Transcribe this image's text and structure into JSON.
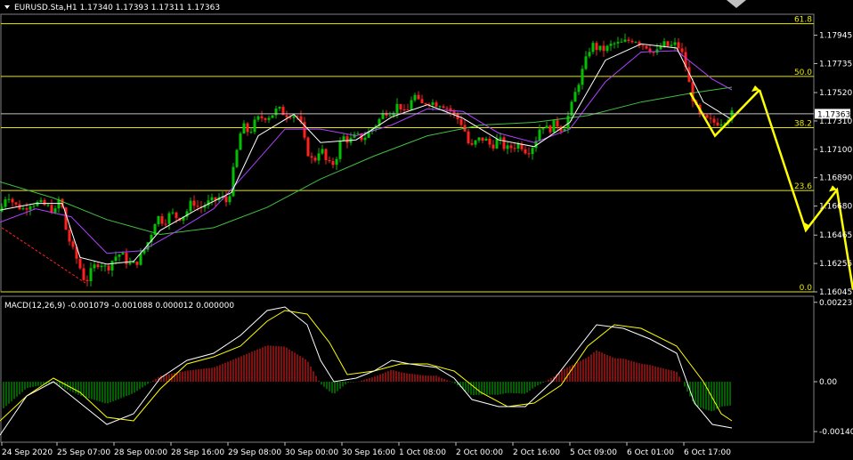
{
  "header": {
    "symbol_line": "EURUSD.Sta,H1  1.17340 1.17393 1.17311 1.17363",
    "macd_line": "MACD(12,26,9) -0.001079 -0.001088 0.000012 0.000000"
  },
  "chart_data": {
    "type": "candlestick",
    "price_axis": {
      "ticks": [
        "1.17945",
        "1.17735",
        "1.17520",
        "1.17310",
        "1.17100",
        "1.16890",
        "1.16680",
        "1.16465",
        "1.16255",
        "1.16045"
      ],
      "current_price": "1.17363",
      "range": [
        1.16045,
        1.181
      ]
    },
    "macd_axis": {
      "ticks": [
        "0.002231",
        "0.00",
        "-0.001401"
      ],
      "range": [
        -0.0017,
        0.0024
      ]
    },
    "time_axis": {
      "labels": [
        "24 Sep 2020",
        "25 Sep 07:00",
        "28 Sep 00:00",
        "28 Sep 16:00",
        "29 Sep 08:00",
        "30 Sep 00:00",
        "30 Sep 16:00",
        "1 Oct 08:00",
        "2 Oct 00:00",
        "2 Oct 16:00",
        "5 Oct 09:00",
        "6 Oct 01:00",
        "6 Oct 17:00"
      ]
    },
    "fibonacci": [
      {
        "label": "61.8",
        "price": 1.1803
      },
      {
        "label": "50.0",
        "price": 1.1764
      },
      {
        "label": "38.2",
        "price": 1.1726
      },
      {
        "label": "23.6",
        "price": 1.16795
      },
      {
        "label": "0.0",
        "price": 1.16045
      }
    ],
    "price_path": [
      [
        0,
        1.1664
      ],
      [
        8,
        1.1678
      ],
      [
        16,
        1.1669
      ],
      [
        26,
        1.1666
      ],
      [
        34,
        1.167
      ],
      [
        44,
        1.167
      ],
      [
        52,
        1.1668
      ],
      [
        62,
        1.1664
      ],
      [
        68,
        1.1677
      ],
      [
        72,
        1.1655
      ],
      [
        80,
        1.1638
      ],
      [
        88,
        1.1626
      ],
      [
        96,
        1.1611
      ],
      [
        104,
        1.1622
      ],
      [
        112,
        1.1627
      ],
      [
        120,
        1.1621
      ],
      [
        128,
        1.163
      ],
      [
        136,
        1.1633
      ],
      [
        144,
        1.1625
      ],
      [
        152,
        1.1625
      ],
      [
        160,
        1.1633
      ],
      [
        168,
        1.1644
      ],
      [
        176,
        1.1661
      ],
      [
        184,
        1.1656
      ],
      [
        192,
        1.1663
      ],
      [
        200,
        1.1659
      ],
      [
        208,
        1.1662
      ],
      [
        216,
        1.1672
      ],
      [
        224,
        1.1666
      ],
      [
        232,
        1.167
      ],
      [
        240,
        1.1672
      ],
      [
        248,
        1.1675
      ],
      [
        256,
        1.167
      ],
      [
        264,
        1.1702
      ],
      [
        272,
        1.1728
      ],
      [
        280,
        1.1722
      ],
      [
        288,
        1.1732
      ],
      [
        296,
        1.1734
      ],
      [
        304,
        1.1735
      ],
      [
        312,
        1.174
      ],
      [
        320,
        1.1736
      ],
      [
        328,
        1.1736
      ],
      [
        336,
        1.1734
      ],
      [
        344,
        1.171
      ],
      [
        352,
        1.17
      ],
      [
        360,
        1.1712
      ],
      [
        368,
        1.1698
      ],
      [
        376,
        1.17
      ],
      [
        384,
        1.172
      ],
      [
        392,
        1.1716
      ],
      [
        400,
        1.172
      ],
      [
        408,
        1.1718
      ],
      [
        416,
        1.1724
      ],
      [
        424,
        1.173
      ],
      [
        432,
        1.1738
      ],
      [
        440,
        1.1738
      ],
      [
        448,
        1.1744
      ],
      [
        456,
        1.1734
      ],
      [
        464,
        1.1752
      ],
      [
        472,
        1.1742
      ],
      [
        480,
        1.1746
      ],
      [
        488,
        1.1744
      ],
      [
        496,
        1.1744
      ],
      [
        504,
        1.174
      ],
      [
        512,
        1.1734
      ],
      [
        520,
        1.1728
      ],
      [
        528,
        1.171
      ],
      [
        536,
        1.1717
      ],
      [
        544,
        1.1718
      ],
      [
        552,
        1.1712
      ],
      [
        560,
        1.1718
      ],
      [
        568,
        1.171
      ],
      [
        576,
        1.1712
      ],
      [
        584,
        1.1714
      ],
      [
        592,
        1.1708
      ],
      [
        600,
        1.1714
      ],
      [
        608,
        1.1729
      ],
      [
        616,
        1.1724
      ],
      [
        624,
        1.173
      ],
      [
        632,
        1.1724
      ],
      [
        640,
        1.1738
      ],
      [
        648,
        1.1756
      ],
      [
        656,
        1.1772
      ],
      [
        664,
        1.1788
      ],
      [
        672,
        1.1784
      ],
      [
        680,
        1.1784
      ],
      [
        688,
        1.1788
      ],
      [
        696,
        1.1788
      ],
      [
        704,
        1.179
      ],
      [
        712,
        1.1792
      ],
      [
        720,
        1.1788
      ],
      [
        728,
        1.1786
      ],
      [
        736,
        1.178
      ],
      [
        744,
        1.1788
      ],
      [
        752,
        1.1786
      ],
      [
        760,
        1.1788
      ],
      [
        768,
        1.1778
      ],
      [
        776,
        1.1752
      ],
      [
        784,
        1.1736
      ],
      [
        792,
        1.1732
      ],
      [
        800,
        1.173
      ],
      [
        808,
        1.173
      ],
      [
        816,
        1.1733
      ],
      [
        822,
        1.17363
      ]
    ],
    "ma_fast": [
      [
        0,
        1.1665
      ],
      [
        40,
        1.167
      ],
      [
        70,
        1.167
      ],
      [
        90,
        1.163
      ],
      [
        120,
        1.1625
      ],
      [
        150,
        1.1627
      ],
      [
        180,
        1.165
      ],
      [
        220,
        1.1665
      ],
      [
        260,
        1.1678
      ],
      [
        290,
        1.172
      ],
      [
        330,
        1.1736
      ],
      [
        360,
        1.1715
      ],
      [
        400,
        1.1717
      ],
      [
        440,
        1.1734
      ],
      [
        480,
        1.1743
      ],
      [
        520,
        1.1733
      ],
      [
        560,
        1.1717
      ],
      [
        600,
        1.1712
      ],
      [
        640,
        1.173
      ],
      [
        680,
        1.1776
      ],
      [
        720,
        1.1788
      ],
      [
        760,
        1.1785
      ],
      [
        790,
        1.1745
      ],
      [
        822,
        1.1732
      ]
    ],
    "ma_mid": [
      [
        0,
        1.1656
      ],
      [
        40,
        1.1666
      ],
      [
        80,
        1.166
      ],
      [
        120,
        1.1633
      ],
      [
        160,
        1.1635
      ],
      [
        200,
        1.165
      ],
      [
        240,
        1.1666
      ],
      [
        280,
        1.1695
      ],
      [
        320,
        1.1725
      ],
      [
        360,
        1.1725
      ],
      [
        400,
        1.172
      ],
      [
        440,
        1.1728
      ],
      [
        480,
        1.174
      ],
      [
        520,
        1.1738
      ],
      [
        560,
        1.1722
      ],
      [
        600,
        1.1715
      ],
      [
        640,
        1.1725
      ],
      [
        680,
        1.176
      ],
      [
        720,
        1.1782
      ],
      [
        760,
        1.1783
      ],
      [
        800,
        1.1762
      ],
      [
        822,
        1.1754
      ]
    ],
    "ma_slow": [
      [
        0,
        1.1686
      ],
      [
        60,
        1.1674
      ],
      [
        120,
        1.1658
      ],
      [
        180,
        1.1647
      ],
      [
        240,
        1.1652
      ],
      [
        300,
        1.1667
      ],
      [
        360,
        1.1688
      ],
      [
        420,
        1.1705
      ],
      [
        480,
        1.172
      ],
      [
        540,
        1.1728
      ],
      [
        600,
        1.173
      ],
      [
        660,
        1.1735
      ],
      [
        720,
        1.1745
      ],
      [
        780,
        1.1752
      ],
      [
        822,
        1.1756
      ]
    ],
    "macd_main": [
      [
        0,
        -0.0015
      ],
      [
        30,
        -0.0004
      ],
      [
        60,
        0.0
      ],
      [
        90,
        -0.0006
      ],
      [
        120,
        -0.0012
      ],
      [
        150,
        -0.0009
      ],
      [
        180,
        0.0001
      ],
      [
        210,
        0.0006
      ],
      [
        240,
        0.0008
      ],
      [
        270,
        0.0013
      ],
      [
        300,
        0.002
      ],
      [
        320,
        0.0021
      ],
      [
        345,
        0.0016
      ],
      [
        360,
        0.0006
      ],
      [
        375,
        0.0
      ],
      [
        400,
        0.0001
      ],
      [
        420,
        0.0003
      ],
      [
        440,
        0.0006
      ],
      [
        460,
        0.0005
      ],
      [
        490,
        0.0004
      ],
      [
        510,
        0.0001
      ],
      [
        530,
        -0.0005
      ],
      [
        560,
        -0.0007
      ],
      [
        590,
        -0.0007
      ],
      [
        620,
        0.0
      ],
      [
        645,
        0.0008
      ],
      [
        670,
        0.0016
      ],
      [
        700,
        0.0015
      ],
      [
        730,
        0.0012
      ],
      [
        760,
        0.0008
      ],
      [
        780,
        -0.0006
      ],
      [
        800,
        -0.0012
      ],
      [
        822,
        -0.0013
      ]
    ],
    "macd_signal": [
      [
        0,
        -0.0011
      ],
      [
        30,
        -0.0004
      ],
      [
        60,
        0.0001
      ],
      [
        90,
        -0.0003
      ],
      [
        120,
        -0.001
      ],
      [
        150,
        -0.0011
      ],
      [
        180,
        -0.0002
      ],
      [
        210,
        0.0005
      ],
      [
        240,
        0.0007
      ],
      [
        270,
        0.001
      ],
      [
        300,
        0.0017
      ],
      [
        320,
        0.002
      ],
      [
        345,
        0.0019
      ],
      [
        370,
        0.0011
      ],
      [
        390,
        0.0002
      ],
      [
        420,
        0.0003
      ],
      [
        450,
        0.0005
      ],
      [
        480,
        0.0005
      ],
      [
        510,
        0.0003
      ],
      [
        540,
        -0.0003
      ],
      [
        570,
        -0.0007
      ],
      [
        600,
        -0.0006
      ],
      [
        630,
        -0.0001
      ],
      [
        660,
        0.001
      ],
      [
        690,
        0.0016
      ],
      [
        720,
        0.0015
      ],
      [
        760,
        0.001
      ],
      [
        790,
        0.0
      ],
      [
        810,
        -0.0009
      ],
      [
        822,
        -0.0011
      ]
    ],
    "forecast_arrows": [
      [
        [
          775,
          1.1752
        ],
        [
          803,
          1.172
        ],
        [
          853,
          1.1754
        ]
      ],
      [
        [
          853,
          1.1754
        ],
        [
          905,
          1.165
        ],
        [
          940,
          1.168
        ],
        [
          958,
          1.1606
        ]
      ]
    ],
    "colors": {
      "background": "#000000",
      "bull_candle": "#00c000",
      "bear_candle": "#ff2020",
      "fibonacci": "#e8e800",
      "ma_fast": "#ffffff",
      "ma_mid": "#b040ff",
      "ma_slow": "#40c040",
      "macd_main": "#ffffff",
      "macd_signal": "#ffff00",
      "arrow": "#ffff00",
      "trendline": "#ff2020"
    }
  }
}
